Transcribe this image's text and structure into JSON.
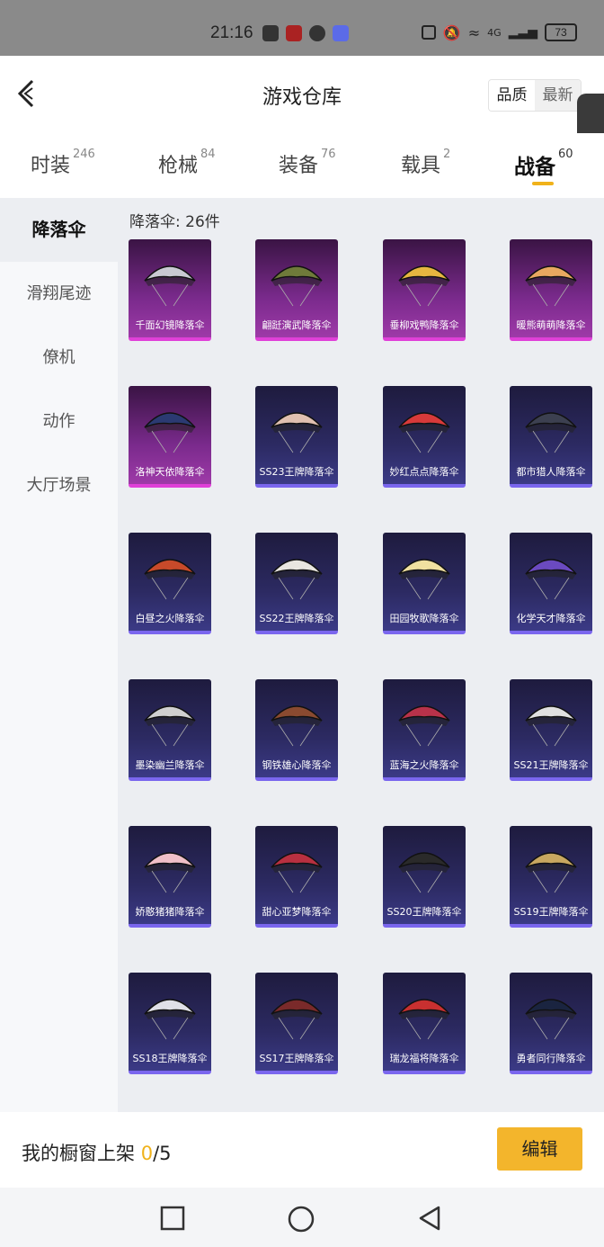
{
  "status": {
    "time": "21:16",
    "net": "4G",
    "battery": "73"
  },
  "header": {
    "title": "游戏仓库",
    "sort_quality": "品质",
    "sort_latest": "最新"
  },
  "tabs": [
    {
      "label": "时装",
      "count": "246"
    },
    {
      "label": "枪械",
      "count": "84"
    },
    {
      "label": "装备",
      "count": "76"
    },
    {
      "label": "载具",
      "count": "2"
    },
    {
      "label": "战备",
      "count": "60"
    }
  ],
  "sidebar": {
    "items": [
      "降落伞",
      "滑翔尾迹",
      "僚机",
      "动作",
      "大厅场景"
    ]
  },
  "main": {
    "count_label": "降落伞: 26件",
    "items": [
      {
        "name": "千面幻镜降落伞",
        "rarity": "purple"
      },
      {
        "name": "翩跹演武降落伞",
        "rarity": "purple"
      },
      {
        "name": "垂柳戏鸭降落伞",
        "rarity": "purple"
      },
      {
        "name": "暖熊萌萌降落伞",
        "rarity": "purple"
      },
      {
        "name": "洛神天依降落伞",
        "rarity": "purple"
      },
      {
        "name": "SS23王牌降落伞",
        "rarity": "blue"
      },
      {
        "name": "妙红点点降落伞",
        "rarity": "blue"
      },
      {
        "name": "都市猎人降落伞",
        "rarity": "blue"
      },
      {
        "name": "白昼之火降落伞",
        "rarity": "blue"
      },
      {
        "name": "SS22王牌降落伞",
        "rarity": "blue"
      },
      {
        "name": "田园牧歌降落伞",
        "rarity": "blue"
      },
      {
        "name": "化学天才降落伞",
        "rarity": "blue"
      },
      {
        "name": "墨染幽兰降落伞",
        "rarity": "blue"
      },
      {
        "name": "钢铁雄心降落伞",
        "rarity": "blue"
      },
      {
        "name": "蓝海之火降落伞",
        "rarity": "blue"
      },
      {
        "name": "SS21王牌降落伞",
        "rarity": "blue"
      },
      {
        "name": "娇憨猪猪降落伞",
        "rarity": "blue"
      },
      {
        "name": "甜心亚梦降落伞",
        "rarity": "blue"
      },
      {
        "name": "SS20王牌降落伞",
        "rarity": "blue"
      },
      {
        "name": "SS19王牌降落伞",
        "rarity": "blue"
      },
      {
        "name": "SS18王牌降落伞",
        "rarity": "blue"
      },
      {
        "name": "SS17王牌降落伞",
        "rarity": "blue"
      },
      {
        "name": "瑞龙福将降落伞",
        "rarity": "blue"
      },
      {
        "name": "勇者同行降落伞",
        "rarity": "blue"
      }
    ]
  },
  "footer": {
    "label": "我的橱窗上架",
    "current": "0",
    "total": "/5",
    "edit": "编辑"
  },
  "colors": {
    "accent": "#f3b52c",
    "purple_rarity": "#e040d8",
    "blue_rarity": "#7a66ee"
  }
}
